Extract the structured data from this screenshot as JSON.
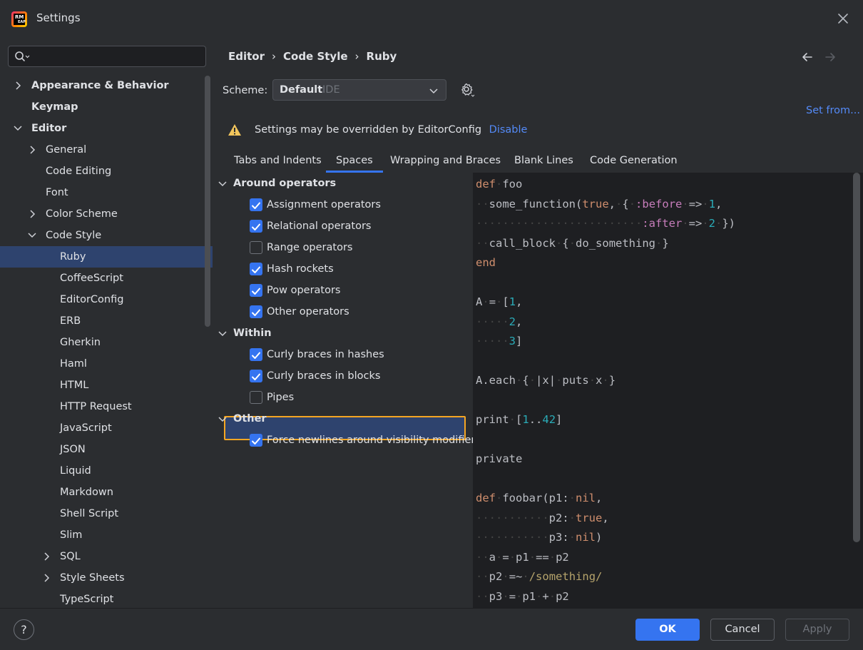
{
  "window": {
    "title": "Settings",
    "logo_text": "RM\nEAP"
  },
  "sidebar": {
    "search_placeholder": "",
    "items": [
      {
        "label": "Appearance & Behavior",
        "level": 0,
        "chevron": "right",
        "bold": true
      },
      {
        "label": "Keymap",
        "level": 0,
        "chevron": "",
        "bold": true
      },
      {
        "label": "Editor",
        "level": 0,
        "chevron": "down",
        "bold": true
      },
      {
        "label": "General",
        "level": 1,
        "chevron": "right"
      },
      {
        "label": "Code Editing",
        "level": 1,
        "chevron": ""
      },
      {
        "label": "Font",
        "level": 1,
        "chevron": ""
      },
      {
        "label": "Color Scheme",
        "level": 1,
        "chevron": "right"
      },
      {
        "label": "Code Style",
        "level": 1,
        "chevron": "down"
      },
      {
        "label": "Ruby",
        "level": 2,
        "chevron": "",
        "selected": true
      },
      {
        "label": "CoffeeScript",
        "level": 2,
        "chevron": ""
      },
      {
        "label": "EditorConfig",
        "level": 2,
        "chevron": ""
      },
      {
        "label": "ERB",
        "level": 2,
        "chevron": ""
      },
      {
        "label": "Gherkin",
        "level": 2,
        "chevron": ""
      },
      {
        "label": "Haml",
        "level": 2,
        "chevron": ""
      },
      {
        "label": "HTML",
        "level": 2,
        "chevron": ""
      },
      {
        "label": "HTTP Request",
        "level": 2,
        "chevron": ""
      },
      {
        "label": "JavaScript",
        "level": 2,
        "chevron": ""
      },
      {
        "label": "JSON",
        "level": 2,
        "chevron": ""
      },
      {
        "label": "Liquid",
        "level": 2,
        "chevron": ""
      },
      {
        "label": "Markdown",
        "level": 2,
        "chevron": ""
      },
      {
        "label": "Shell Script",
        "level": 2,
        "chevron": ""
      },
      {
        "label": "Slim",
        "level": 2,
        "chevron": ""
      },
      {
        "label": "SQL",
        "level": 2,
        "chevron": "right"
      },
      {
        "label": "Style Sheets",
        "level": 2,
        "chevron": "right"
      },
      {
        "label": "TypeScript",
        "level": 2,
        "chevron": ""
      }
    ]
  },
  "header": {
    "breadcrumb": [
      "Editor",
      "Code Style",
      "Ruby"
    ],
    "scheme_label": "Scheme:",
    "scheme_name": "Default",
    "scheme_sub": "IDE",
    "set_from": "Set from...",
    "warning_text": "Settings may be overridden by EditorConfig",
    "warning_link": "Disable"
  },
  "tabs": [
    {
      "label": "Tabs and Indents",
      "active": false
    },
    {
      "label": "Spaces",
      "active": true
    },
    {
      "label": "Wrapping and Braces",
      "active": false
    },
    {
      "label": "Blank Lines",
      "active": false
    },
    {
      "label": "Code Generation",
      "active": false
    }
  ],
  "options": [
    {
      "type": "group",
      "label": "Around operators"
    },
    {
      "type": "item",
      "label": "Assignment operators",
      "checked": true
    },
    {
      "type": "item",
      "label": "Relational operators",
      "checked": true
    },
    {
      "type": "item",
      "label": "Range operators",
      "checked": false
    },
    {
      "type": "item",
      "label": "Hash rockets",
      "checked": true
    },
    {
      "type": "item",
      "label": "Pow operators",
      "checked": true,
      "highlighted": true
    },
    {
      "type": "item",
      "label": "Other operators",
      "checked": true
    },
    {
      "type": "group",
      "label": "Within"
    },
    {
      "type": "item",
      "label": "Curly braces in hashes",
      "checked": true
    },
    {
      "type": "item",
      "label": "Curly braces in blocks",
      "checked": true
    },
    {
      "type": "item",
      "label": "Pipes",
      "checked": false
    },
    {
      "type": "group",
      "label": "Other"
    },
    {
      "type": "item",
      "label": "Force newlines around visibility modifiers",
      "checked": true
    }
  ],
  "code_lines": [
    [
      [
        "kw",
        "def"
      ],
      [
        "d",
        "·"
      ],
      [
        "t",
        "foo"
      ]
    ],
    [
      [
        "d",
        "··"
      ],
      [
        "t",
        "some_function("
      ],
      [
        "kw",
        "true"
      ],
      [
        "t",
        ","
      ],
      [
        "d",
        "·"
      ],
      [
        "t",
        "{"
      ],
      [
        "d",
        "·"
      ],
      [
        "sym",
        ":before"
      ],
      [
        "d",
        "·"
      ],
      [
        "t",
        "=>"
      ],
      [
        "d",
        "·"
      ],
      [
        "num2",
        "1"
      ],
      [
        "t",
        ","
      ]
    ],
    [
      [
        "d",
        "·························"
      ],
      [
        "sym",
        ":after"
      ],
      [
        "d",
        "·"
      ],
      [
        "t",
        "=>"
      ],
      [
        "d",
        "·"
      ],
      [
        "num2",
        "2"
      ],
      [
        "d",
        "·"
      ],
      [
        "t",
        "})"
      ]
    ],
    [
      [
        "d",
        "··"
      ],
      [
        "t",
        "call_block"
      ],
      [
        "d",
        "·"
      ],
      [
        "t",
        "{"
      ],
      [
        "d",
        "·"
      ],
      [
        "t",
        "do_something"
      ],
      [
        "d",
        "·"
      ],
      [
        "t",
        "}"
      ]
    ],
    [
      [
        "kw",
        "end"
      ]
    ],
    [],
    [
      [
        "t",
        "A"
      ],
      [
        "d",
        "·"
      ],
      [
        "t",
        "="
      ],
      [
        "d",
        "·"
      ],
      [
        "t",
        "["
      ],
      [
        "num2",
        "1"
      ],
      [
        "t",
        ","
      ]
    ],
    [
      [
        "d",
        "·····"
      ],
      [
        "num2",
        "2"
      ],
      [
        "t",
        ","
      ]
    ],
    [
      [
        "d",
        "·····"
      ],
      [
        "num2",
        "3"
      ],
      [
        "t",
        "]"
      ]
    ],
    [],
    [
      [
        "t",
        "A.each"
      ],
      [
        "d",
        "·"
      ],
      [
        "t",
        "{"
      ],
      [
        "d",
        "·"
      ],
      [
        "t",
        "|x|"
      ],
      [
        "d",
        "·"
      ],
      [
        "t",
        "puts"
      ],
      [
        "d",
        "·"
      ],
      [
        "t",
        "x"
      ],
      [
        "d",
        "·"
      ],
      [
        "t",
        "}"
      ]
    ],
    [],
    [
      [
        "t",
        "print"
      ],
      [
        "d",
        "·"
      ],
      [
        "t",
        "["
      ],
      [
        "num2",
        "1"
      ],
      [
        "t",
        ".."
      ],
      [
        "num2",
        "42"
      ],
      [
        "t",
        "]"
      ]
    ],
    [],
    [
      [
        "t",
        "private"
      ]
    ],
    [],
    [
      [
        "kw",
        "def"
      ],
      [
        "d",
        "·"
      ],
      [
        "t",
        "foobar(p1:"
      ],
      [
        "d",
        "·"
      ],
      [
        "kw",
        "nil"
      ],
      [
        "t",
        ","
      ]
    ],
    [
      [
        "d",
        "···········"
      ],
      [
        "t",
        "p2:"
      ],
      [
        "d",
        "·"
      ],
      [
        "kw",
        "true"
      ],
      [
        "t",
        ","
      ]
    ],
    [
      [
        "d",
        "···········"
      ],
      [
        "t",
        "p3:"
      ],
      [
        "d",
        "·"
      ],
      [
        "kw",
        "nil"
      ],
      [
        "t",
        ")"
      ]
    ],
    [
      [
        "d",
        "··"
      ],
      [
        "t",
        "a"
      ],
      [
        "d",
        "·"
      ],
      [
        "t",
        "="
      ],
      [
        "d",
        "·"
      ],
      [
        "t",
        "p1"
      ],
      [
        "d",
        "·"
      ],
      [
        "t",
        "=="
      ],
      [
        "d",
        "·"
      ],
      [
        "t",
        "p2"
      ]
    ],
    [
      [
        "d",
        "··"
      ],
      [
        "t",
        "p2"
      ],
      [
        "d",
        "·"
      ],
      [
        "t",
        "=~"
      ],
      [
        "d",
        "·"
      ],
      [
        "re",
        "/something/"
      ]
    ],
    [
      [
        "d",
        "··"
      ],
      [
        "t",
        "p3"
      ],
      [
        "d",
        "·"
      ],
      [
        "t",
        "="
      ],
      [
        "d",
        "·"
      ],
      [
        "t",
        "p1"
      ],
      [
        "d",
        "·"
      ],
      [
        "t",
        "+"
      ],
      [
        "d",
        "·"
      ],
      [
        "t",
        "p2"
      ]
    ]
  ],
  "footer": {
    "help": "?",
    "ok": "OK",
    "cancel": "Cancel",
    "apply": "Apply"
  },
  "colors": {
    "accent": "#3574f0",
    "link": "#548af7",
    "highlight_border": "#f5a623",
    "selection": "#2e436e"
  }
}
